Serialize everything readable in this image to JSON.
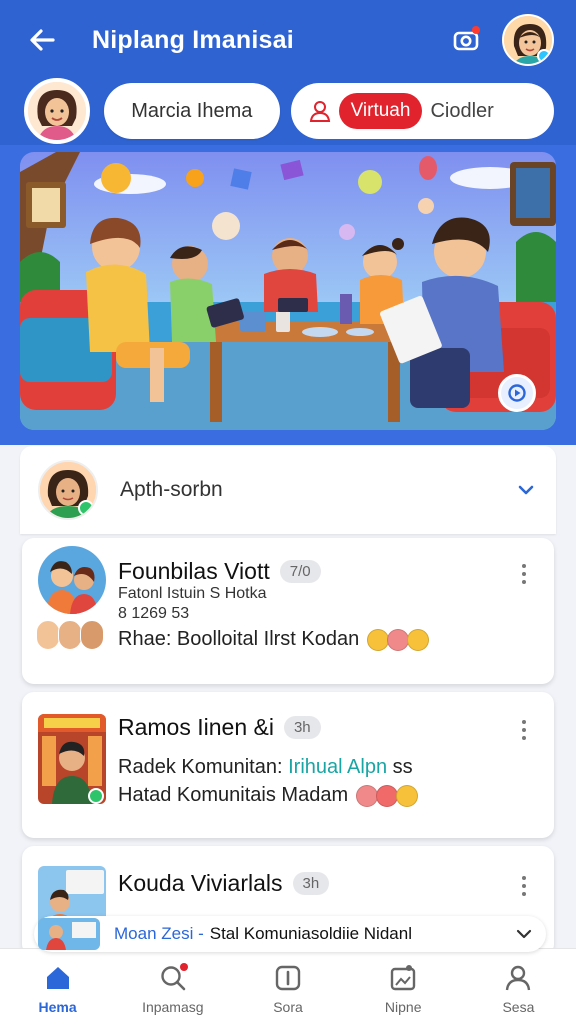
{
  "header": {
    "title": "Niplang Imanisai",
    "back_icon": "arrow-left-icon",
    "camera_icon": "camera-icon",
    "accent": "#2f63d1"
  },
  "pills": {
    "name": "Marcia Ihema",
    "mode_active": "Virtuah",
    "mode_alt": "Ciodler",
    "accent_red": "#e0232d"
  },
  "group": {
    "name": "Apth-sorbn"
  },
  "posts": [
    {
      "name": "Founbilas Viott",
      "count": "7/0",
      "sub1": "Fatonl Istuin S Hotka",
      "sub2": "8 1269 53",
      "text": "Rhae: Boolloital Ilrst Kodan"
    },
    {
      "name": "Ramos Iinen &i",
      "count": "3h",
      "line1_prefix": "Radek Komunitan:",
      "line1_highlight": "Irihual Alpn",
      "line1_suffix": "ss",
      "line2": "Hatad Komunitais Madam"
    },
    {
      "name": "Kouda Viviarlals",
      "count": "3h"
    }
  ],
  "banner": {
    "prefix": "Moan Zesi -",
    "text": "Stal Komuniasoldiie Nidanl"
  },
  "nav": [
    {
      "label": "Hema",
      "icon": "home-icon",
      "active": true
    },
    {
      "label": "Inpamasg",
      "icon": "search-icon",
      "active": false
    },
    {
      "label": "Sora",
      "icon": "add-square-icon",
      "active": false
    },
    {
      "label": "Nipne",
      "icon": "image-edit-icon",
      "active": false
    },
    {
      "label": "Sesa",
      "icon": "profile-icon",
      "active": false
    }
  ]
}
